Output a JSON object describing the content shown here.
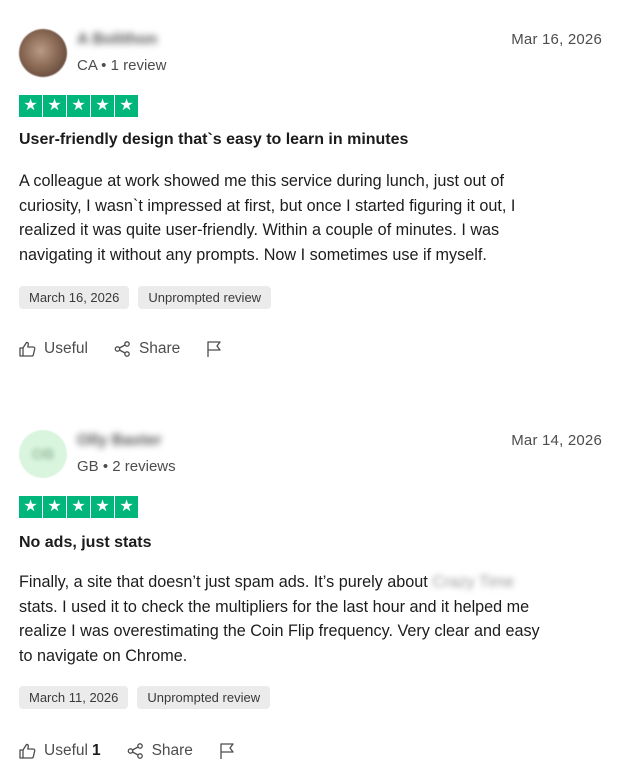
{
  "reviews": [
    {
      "avatar_initials": "",
      "reviewer_name": "A Bolithon",
      "country": "CA",
      "review_count": "1 review",
      "date": "Mar 16, 2026",
      "rating": 5,
      "title": "User-friendly design that`s easy to learn in minutes",
      "body_lines": [
        "A colleague at work showed me this service during lunch, just out of",
        "curiosity, I wasn`t impressed at first, but once I started figuring it out, I",
        "realized it was quite user-friendly. Within a couple of minutes. I was",
        "navigating it without any prompts. Now I sometimes use if myself."
      ],
      "experience_date": "March 16, 2026",
      "tag": "Unprompted review",
      "useful_label": "Useful",
      "useful_count": "",
      "share_label": "Share"
    },
    {
      "avatar_initials": "OB",
      "reviewer_name": "Olly Baxter",
      "country": "GB",
      "review_count": "2 reviews",
      "date": "Mar 14, 2026",
      "rating": 5,
      "title": "No ads, just stats",
      "body_line1_a": "Finally, a site that doesn’t just spam ads. It’s purely about",
      "body_line1_blur": "Crazy Time",
      "body_lines_rest": [
        "stats. I used it to check the multipliers for the last hour and it helped me",
        "realize I was overestimating the Coin Flip frequency. Very clear and easy",
        "to navigate on Chrome."
      ],
      "experience_date": "March 11, 2026",
      "tag": "Unprompted review",
      "useful_label": "Useful",
      "useful_count": "1",
      "share_label": "Share"
    }
  ],
  "colors": {
    "star_green": "#00b67a",
    "tag_bg": "#ebebeb"
  },
  "icons": [
    "thumbs-up-icon",
    "share-icon",
    "flag-icon",
    "star-icon"
  ]
}
